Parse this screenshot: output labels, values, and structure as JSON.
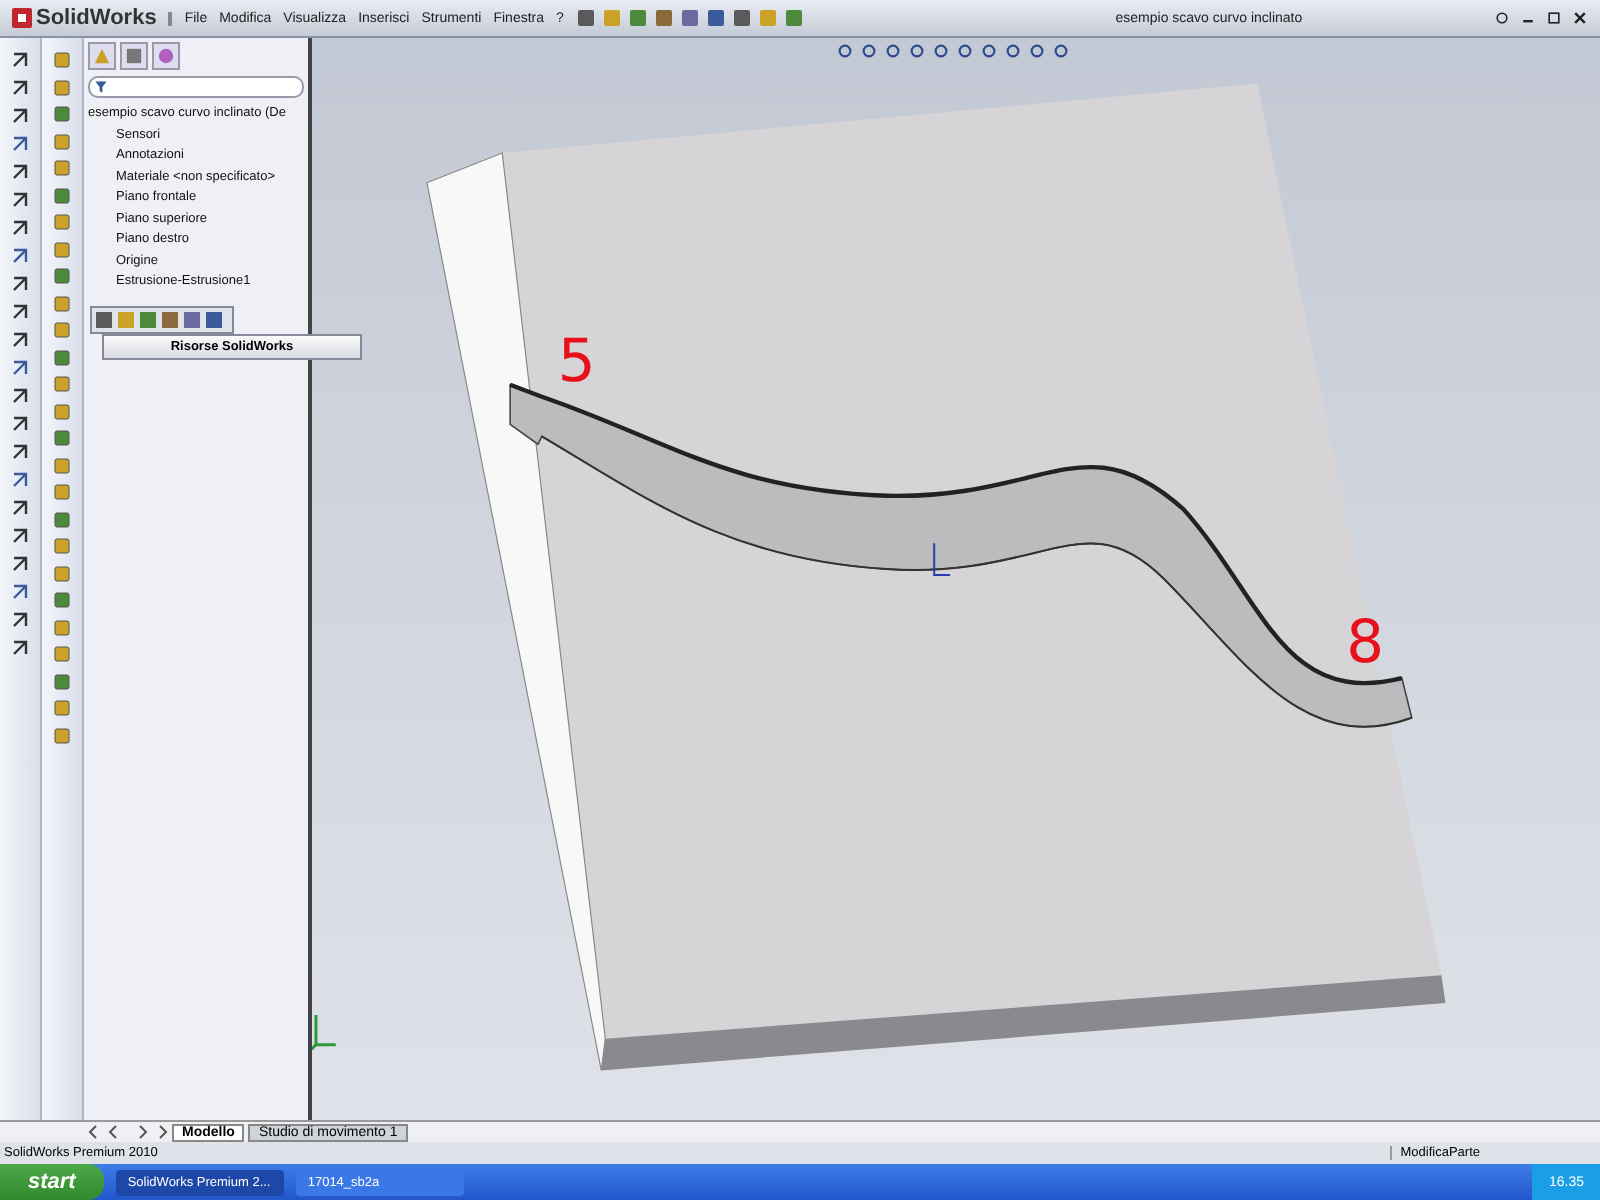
{
  "app": {
    "logo": "SolidWorks",
    "menus": [
      "File",
      "Modifica",
      "Visualizza",
      "Inserisci",
      "Strumenti",
      "Finestra",
      "?"
    ],
    "document_title": "esempio scavo curvo inclinato"
  },
  "feature_tree": {
    "root": {
      "label": "esempio scavo curvo inclinato  (De",
      "children": [
        {
          "label": "Sensori"
        },
        {
          "label": "Annotazioni"
        },
        {
          "label": "Materiale <non specificato>"
        },
        {
          "label": "Piano frontale"
        },
        {
          "label": "Piano superiore"
        },
        {
          "label": "Piano destro"
        },
        {
          "label": "Origine"
        },
        {
          "label": "Estrusione-Estrusione1"
        }
      ]
    },
    "popup_tooltip": "Risorse SolidWorks"
  },
  "viewport": {
    "annotations": [
      {
        "text": "5",
        "color": "#e8101a"
      },
      {
        "text": "8",
        "color": "#e8101a"
      }
    ]
  },
  "bottom_tabs": [
    {
      "label": "Modello",
      "selected": true
    },
    {
      "label": "Studio di movimento 1",
      "selected": false
    }
  ],
  "status_bar": {
    "app_name": "SolidWorks Premium 2010",
    "mode": "ModificaParte"
  },
  "taskbar": {
    "start": "start",
    "tasks": [
      {
        "label": "SolidWorks Premium 2...",
        "selected": true
      },
      {
        "label": "17014_sb2a",
        "selected": false
      }
    ],
    "clock": "16.35"
  }
}
